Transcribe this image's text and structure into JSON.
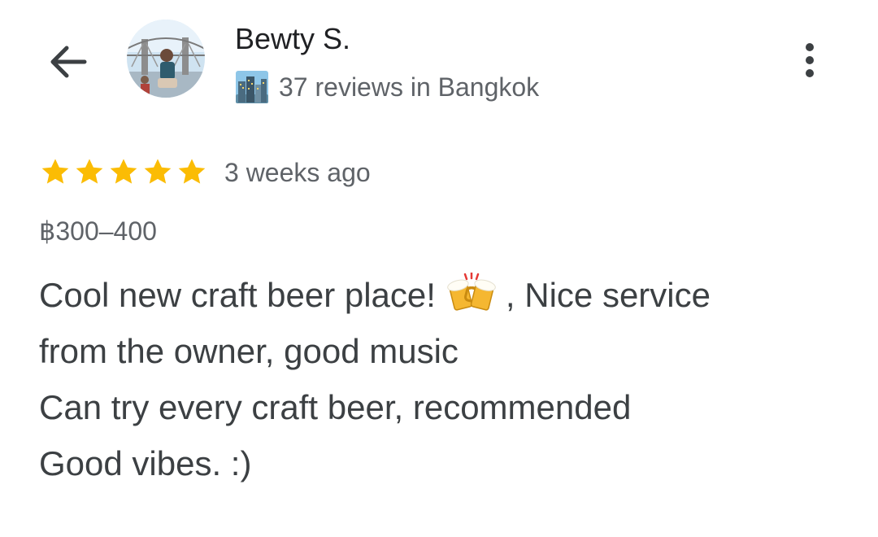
{
  "header": {
    "back_icon": "arrow-left-icon",
    "avatar_icon": "profile-photo",
    "user_name": "Bewty S.",
    "city_icon": "cityscape-icon",
    "review_count": "37 reviews in Bangkok",
    "more_icon": "more-vertical-icon"
  },
  "review": {
    "rating": 5,
    "rating_max": 5,
    "time_ago": "3 weeks ago",
    "price_range": "฿300–400",
    "line1_before": "Cool new craft beer place!",
    "beer_icon": "clinking-beer-mugs-icon",
    "line1_after": ", Nice service",
    "line2": "from the owner, good music",
    "line3": "Can try every craft beer, recommended",
    "line4": "Good vibes. :)"
  },
  "colors": {
    "star": "#fbbc04",
    "primary_text": "#202124",
    "body_text": "#3c4043",
    "secondary_text": "#5f6368"
  }
}
